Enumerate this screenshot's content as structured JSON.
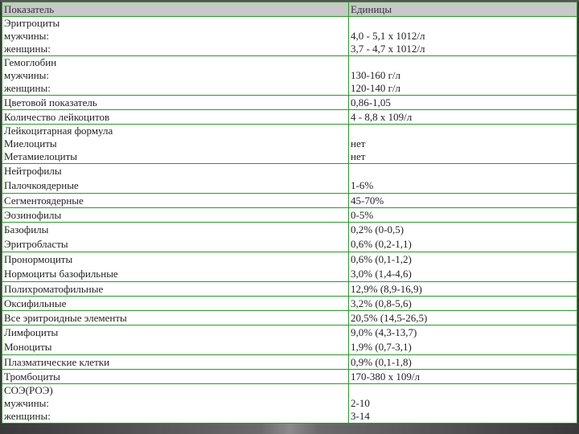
{
  "header": {
    "col1": "Показатель",
    "col2": "Единицы"
  },
  "rows": [
    {
      "name": [
        "Эритроциты",
        "мужчины:",
        "женщины:"
      ],
      "value": [
        "",
        "4,0 - 5,1 x 1012/л",
        "3,7 - 4,7 x 1012/л"
      ]
    },
    {
      "name": [
        "Гемоглобин",
        "мужчины:",
        "женщины:"
      ],
      "value": [
        "",
        "130-160 г/л",
        "120-140 г/л"
      ]
    },
    {
      "name": [
        "Цветовой показатель"
      ],
      "value": [
        "0,86-1,05"
      ]
    },
    {
      "name": [
        "Количество лейкоцитов"
      ],
      "value": [
        "4 - 8,8 x 109/л"
      ]
    },
    {
      "name": [
        "Лейкоцитарная формула",
        "Миелоциты",
        "Метамиелоциты"
      ],
      "value": [
        "",
        "нет",
        "нет"
      ]
    },
    {
      "name": [
        "Нейтрофилы",
        "Палочкоядерные"
      ],
      "value": [
        "",
        "1-6%"
      ]
    },
    {
      "name": [
        "Сегментоядерные"
      ],
      "value": [
        "45-70%"
      ]
    },
    {
      "name": [
        "Эозинофилы"
      ],
      "value": [
        "0-5%"
      ]
    },
    {
      "name": [
        "Базофилы",
        "Эритробласты"
      ],
      "value": [
        "0,2% (0-0,5)",
        "0,6% (0,2-1,1)"
      ]
    },
    {
      "name": [
        "Пронормоциты",
        "Нормоциты базофильные"
      ],
      "value": [
        "0,6% (0,1-1,2)",
        "3,0% (1,4-4,6)"
      ]
    },
    {
      "name": [
        "Полихроматофильные"
      ],
      "value": [
        "12,9% (8,9-16,9)"
      ]
    },
    {
      "name": [
        "Оксифильные"
      ],
      "value": [
        "3,2% (0,8-5,6)"
      ]
    },
    {
      "name": [
        "Все эритроидные элементы"
      ],
      "value": [
        "20,5% (14,5-26,5)"
      ]
    },
    {
      "name": [
        "Лимфоциты",
        "Моноциты"
      ],
      "value": [
        "9,0% (4,3-13,7)",
        "1,9% (0,7-3,1)"
      ]
    },
    {
      "name": [
        "Плазматические клетки"
      ],
      "value": [
        "0,9% (0,1-1,8)"
      ]
    },
    {
      "name": [
        "Тромбоциты"
      ],
      "value": [
        "170-380 x 109/л"
      ]
    },
    {
      "name": [
        "СОЭ(РОЭ)",
        "мужчины:",
        "женщины:"
      ],
      "value": [
        "",
        "2-10",
        "3-14"
      ]
    }
  ]
}
